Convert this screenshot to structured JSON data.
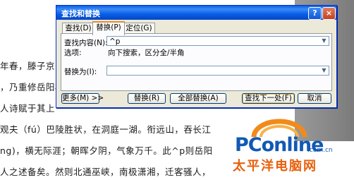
{
  "document": {
    "lines": [
      "年春，滕子京",
      "，乃重修岳阳楼",
      "人诗赋于其上",
      "观夫（fú）巴陵胜状，在洞庭一湖。衔远山，吞长江",
      "ng)，横无际涯；朝晖夕阴，气象万千。此^p则岳阳",
      "人之述备矣。然则北通巫峡，南极潇湘，迁客骚人，"
    ]
  },
  "dialog": {
    "title": "查找和替换",
    "help_glyph": "?",
    "close_glyph": "×",
    "tabs": [
      "查找(D)",
      "替换(P)",
      "定位(G)"
    ],
    "find_label": "查找内容(N):",
    "find_value": "^p",
    "options_label": "选项:",
    "options_value": "向下搜索，区分全/半角",
    "replace_label": "替换为(I):",
    "replace_value": "",
    "more_button": "更多(M) >>",
    "replace_button": "替换(R)",
    "replace_all_button": "全部替换(A)",
    "find_next_button": "查找下一处(F)",
    "cancel_button": "取消"
  },
  "watermark": {
    "brand": "PConline",
    "domain": ".com.cn",
    "cn": "太平洋电脑网"
  },
  "colors": {
    "titlebar": "#0a5ee7",
    "dialog_bg": "#ece9d8",
    "logo_blue": "#1259b4",
    "logo_orange": "#e8600c"
  }
}
